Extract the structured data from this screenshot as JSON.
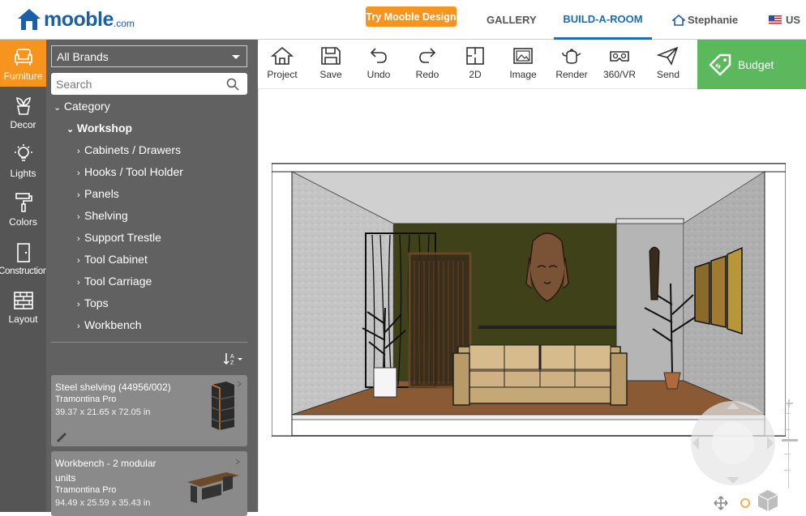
{
  "header": {
    "logo_text": "mooble",
    "logo_suffix": ".com",
    "try_button": "Try Mooble Design",
    "nav_gallery": "GALLERY",
    "nav_build": "BUILD-A-ROOM",
    "user_name": "Stephanie",
    "language": "US"
  },
  "sidebar": {
    "items": [
      {
        "label": "Furniture",
        "icon": "armchair-icon",
        "active": true
      },
      {
        "label": "Decor",
        "icon": "plant-pot-icon"
      },
      {
        "label": "Lights",
        "icon": "light-bulb-icon"
      },
      {
        "label": "Colors",
        "icon": "paint-roller-icon"
      },
      {
        "label": "Construction",
        "icon": "door-icon"
      },
      {
        "label": "Layout",
        "icon": "brick-wall-icon"
      }
    ]
  },
  "catalog": {
    "brand_select": "All Brands",
    "search_placeholder": "Search",
    "category_label": "Category",
    "subcategory": "Workshop",
    "items": [
      "Cabinets / Drawers",
      "Hooks / Tool Holder",
      "Panels",
      "Shelving",
      "Support Trestle",
      "Tool Cabinet",
      "Tool Carriage",
      "Tops",
      "Workbench"
    ],
    "sort_label": "↓AZ"
  },
  "products": [
    {
      "title": "Steel shelving (44956/002)",
      "brand": "Tramontina Pro",
      "dims": "39.37 x 21.65 x 72.05 in"
    },
    {
      "title": "Workbench - 2 modular units",
      "brand": "Tramontina Pro",
      "dims": "94.49 x 25.59 x 35.43 in"
    }
  ],
  "toolbar": {
    "tools": [
      "Project",
      "Save",
      "Undo",
      "Redo",
      "2D",
      "Image",
      "Render",
      "360/VR",
      "Send"
    ],
    "budget_label": "Budget"
  },
  "colors": {
    "accent_orange": "#f7941d",
    "brand_blue": "#1b6db8",
    "budget_green": "#5cb85c",
    "sidebar_dark": "#555555",
    "panel_gray": "#616161"
  }
}
